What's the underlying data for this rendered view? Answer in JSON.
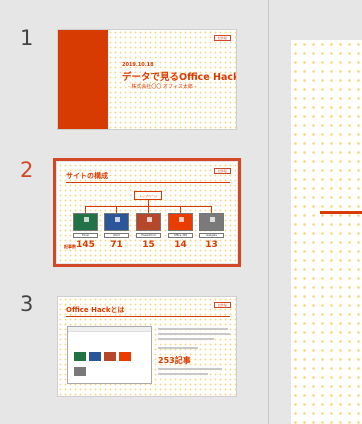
{
  "slides": [
    {
      "number": "1",
      "tag": "社外秘",
      "date": "2019.10.18",
      "title": "データで見るOffice Hack",
      "subtitle": "- 株式会社〇〇 オフィス太郎 -"
    },
    {
      "number": "2",
      "tag": "社外秘",
      "title": "サイトの構成",
      "center_label": "トップページ",
      "count_label": "記事数",
      "sites": [
        {
          "name": "Excel",
          "count": "145",
          "color": "#217346"
        },
        {
          "name": "Word",
          "count": "71",
          "color": "#2b579a"
        },
        {
          "name": "PowerPoint",
          "count": "15",
          "color": "#b7472a"
        },
        {
          "name": "Office 365",
          "count": "14",
          "color": "#eb3c00"
        },
        {
          "name": "Gadgets",
          "count": "13",
          "color": "#7a7a7a"
        }
      ]
    },
    {
      "number": "3",
      "tag": "社外秘",
      "title": "Office Hackとは",
      "stat": "253記事"
    }
  ],
  "selected_slide": "2",
  "colors": {
    "accent": "#d83b01",
    "selection": "#d24726",
    "dots": "#f6d57e"
  }
}
